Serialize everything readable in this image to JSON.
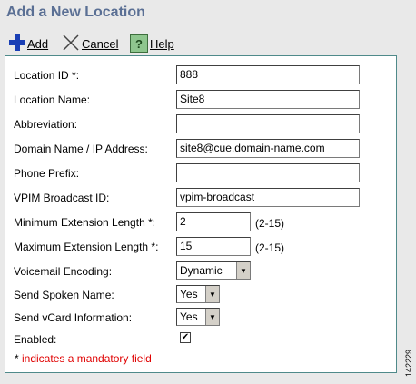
{
  "page": {
    "title": "Add a New Location"
  },
  "toolbar": {
    "add_label": "Add",
    "cancel_label": "Cancel",
    "help_label": "Help",
    "help_glyph": "?"
  },
  "form": {
    "location_id": {
      "label": "Location ID *:",
      "value": "888"
    },
    "location_name": {
      "label": "Location Name:",
      "value": "Site8"
    },
    "abbreviation": {
      "label": "Abbreviation:",
      "value": ""
    },
    "domain": {
      "label": "Domain Name / IP Address:",
      "value": "site8@cue.domain-name.com"
    },
    "phone_prefix": {
      "label": "Phone Prefix:",
      "value": ""
    },
    "vpim_broadcast": {
      "label": "VPIM Broadcast ID:",
      "value": "vpim-broadcast"
    },
    "min_ext": {
      "label": "Minimum Extension Length *:",
      "value": "2",
      "range": "(2-15)"
    },
    "max_ext": {
      "label": "Maximum Extension Length *:",
      "value": "15",
      "range": "(2-15)"
    },
    "voicemail_encoding": {
      "label": "Voicemail Encoding:",
      "value": "Dynamic"
    },
    "spoken_name": {
      "label": "Send Spoken Name:",
      "value": "Yes"
    },
    "vcard": {
      "label": "Send vCard Information:",
      "value": "Yes"
    },
    "enabled": {
      "label": "Enabled:",
      "checked": true,
      "glyph": "✔"
    }
  },
  "footer": {
    "star": "*",
    "mandatory_note": " indicates a mandatory field"
  },
  "figure_number": "142229",
  "colors": {
    "title": "#5a6f94",
    "mandatory": "#e00000",
    "add_icon": "#1a3fb5"
  }
}
